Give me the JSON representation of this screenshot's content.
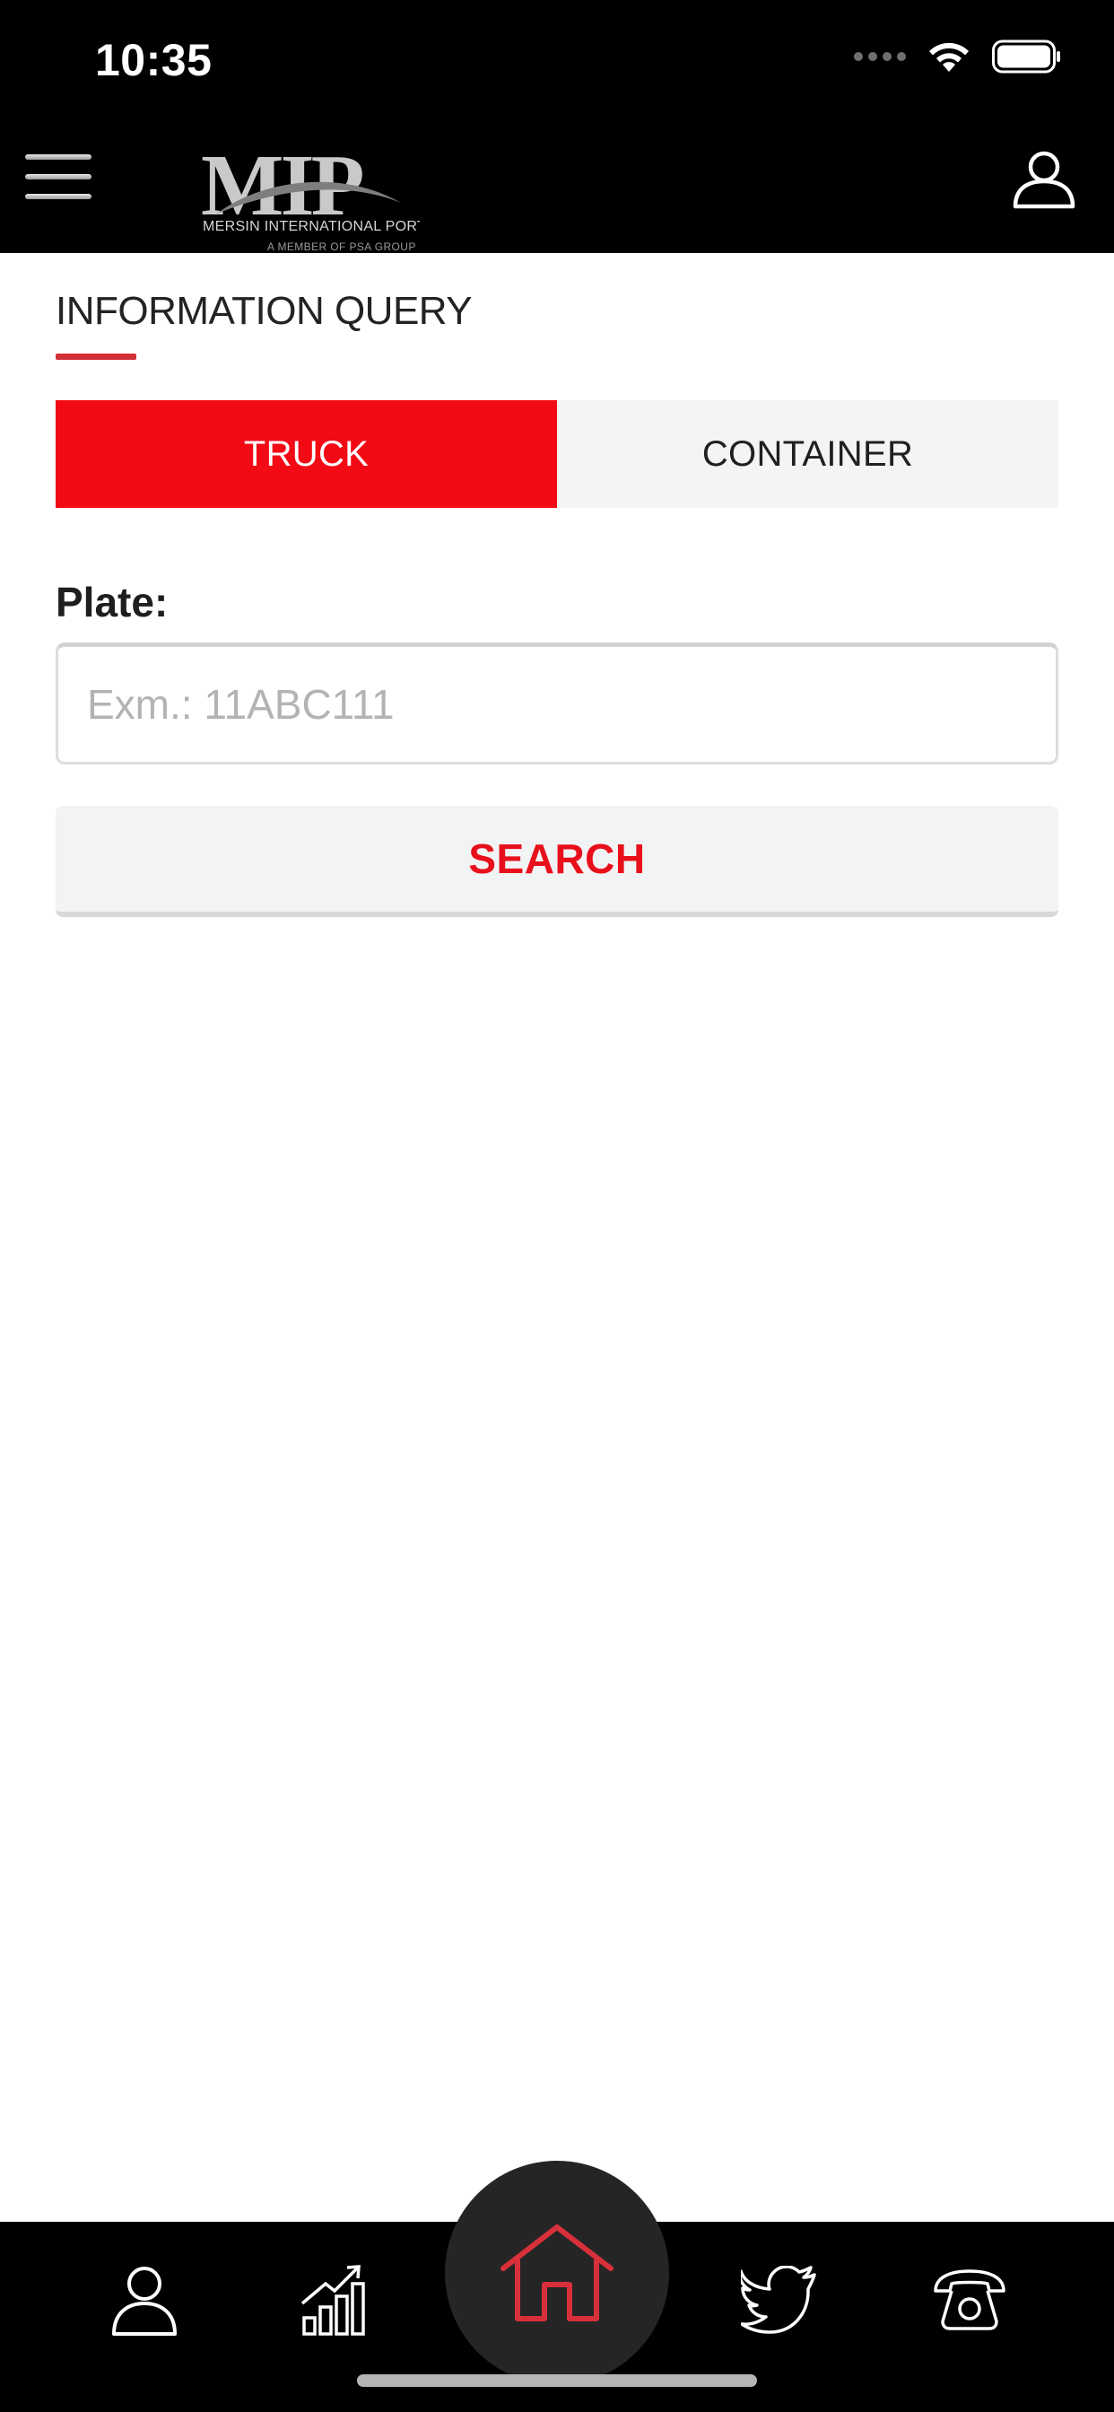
{
  "status_bar": {
    "time": "10:35"
  },
  "header": {
    "logo": {
      "letters": "MIP",
      "subtitle": "MERSIN INTERNATIONAL PORT",
      "tagline": "A MEMBER OF PSA GROUP"
    }
  },
  "page": {
    "title": "INFORMATION QUERY",
    "tabs": [
      {
        "label": "TRUCK",
        "active": true
      },
      {
        "label": "CONTAINER",
        "active": false
      }
    ],
    "plate_field": {
      "label": "Plate:",
      "placeholder": "Exm.: 11ABC111",
      "value": ""
    },
    "search_button": "SEARCH"
  },
  "bottom_nav": {
    "items": [
      {
        "icon": "person-icon"
      },
      {
        "icon": "chart-growth-icon"
      },
      {
        "icon": "home-icon",
        "active": true
      },
      {
        "icon": "twitter-icon"
      },
      {
        "icon": "telephone-icon"
      }
    ]
  },
  "colors": {
    "accent_red": "#f20a15",
    "underline_red": "#d32f36",
    "home_icon_red": "#d8303a",
    "header_bg": "#000000",
    "inactive_tab_bg": "#f4f4f4"
  }
}
